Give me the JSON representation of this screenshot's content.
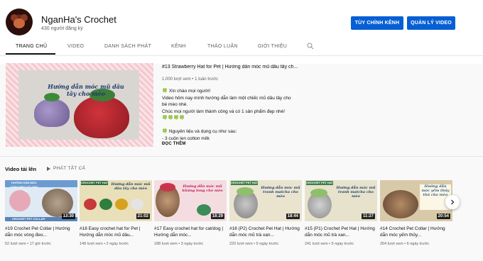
{
  "channel": {
    "name": "NganHa's Crochet",
    "subscribers": "430 người đăng ký",
    "customize_label": "TÙY CHỈNH KÊNH",
    "manage_label": "QUẢN LÝ VIDEO"
  },
  "tabs": [
    {
      "label": "TRANG CHỦ",
      "active": true
    },
    {
      "label": "VIDEO"
    },
    {
      "label": "DANH SÁCH PHÁT"
    },
    {
      "label": "KÊNH"
    },
    {
      "label": "THẢO LUẬN"
    },
    {
      "label": "GIỚI THIỆU"
    }
  ],
  "search_icon": "search-icon",
  "featured": {
    "thumb_text": "Hướng dẫn móc mũ dâu tây cho mèo",
    "title": "#13 Strawberry Hat for Pet | Hướng dẫn móc mũ dâu tây ch...",
    "meta": "1.000 lượt xem • 1 tuần trước",
    "description": [
      "🍀 Xin chào mọi người!",
      "Video hôm nay mình hướng dẫn làm một chiếc mũ dâu tây cho",
      "bé mèo nhé.",
      "Chúc mọi người làm thành công và có 1 sản phẩm đẹp nhé!",
      "🍀🍀🍀🍀",
      "",
      "🍀 Nguyên liệu và dụng cụ như sau:",
      "- 3 cuộn len cotton milk"
    ],
    "more_label": "ĐỌC THÊM"
  },
  "uploads": {
    "title": "Video tải lên",
    "play_all": "PHÁT TẤT CẢ"
  },
  "videos": [
    {
      "title": "#19 Crochet Pet Collar | Hướng dẫn móc vòng đeo...",
      "meta": "52 lượt xem • 17 giờ trước",
      "duration": "13:30",
      "thumb_text": "HƯỚNG DẪN MÓC VÒNG ĐEO CỔ CHO CÚN",
      "thumb_label": "CROCHET PET COLLAR"
    },
    {
      "title": "#18 Easy crochet hat for Pet | Hướng dẫn móc mũ dâu...",
      "meta": "148 lượt xem • 2 ngày trước",
      "duration": "21:02",
      "thumb_text": "Hướng dẫn móc mũ dâu tây cho mèo",
      "thumb_label": "CROCHET PET HAT"
    },
    {
      "title": "#17 Easy crochet hat for cat/dog | Hướng dẫn móc...",
      "meta": "188 lượt xem • 3 ngày trước",
      "duration": "18:29",
      "thumb_text": "Hướng dẫn móc mũ khủng long cho mèo",
      "thumb_label": ""
    },
    {
      "title": "#16 (P2) Crochet Pet Hat | Hướng dẫn móc mũ trà xan...",
      "meta": "220 lượt xem • 5 ngày trước",
      "duration": "18:44",
      "thumb_text": "Hướng dẫn móc mũ tranh matcha cho mèo",
      "thumb_label": "CROCHET PET HAT"
    },
    {
      "title": "#15 (P1) Crochet Pet Hat | Hướng dẫn móc mũ trà xan...",
      "meta": "241 lượt xem • 5 ngày trước",
      "duration": "11:27",
      "thumb_text": "Hướng dẫn móc mũ tranh matcha cho mèo",
      "thumb_label": "CROCHET PET HAT"
    },
    {
      "title": "#14 Crochet Pet Collar | Hướng dẫn móc yếm thủy...",
      "meta": "264 lượt xem • 6 ngày trước",
      "duration": "20:54",
      "thumb_text": "Hướng dẫn móc yếm thủy thủ cho mèo",
      "thumb_label": ""
    }
  ],
  "next_icon": "chevron-right-icon",
  "colors": {
    "accent": "#065fd4",
    "text": "#0f0f0f",
    "muted": "#606060"
  }
}
